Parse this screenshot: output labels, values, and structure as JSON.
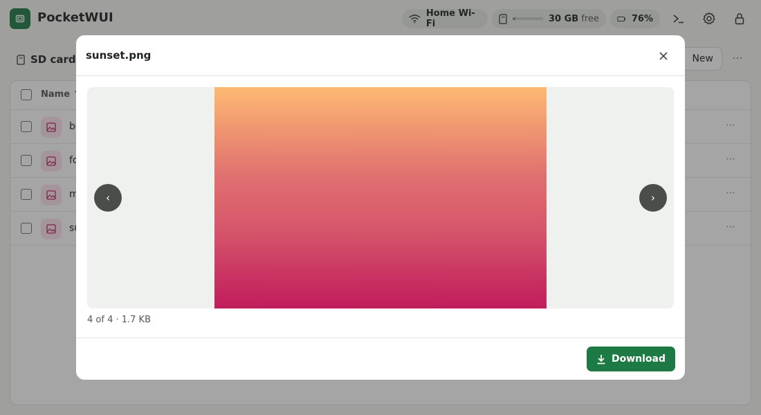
{
  "app": {
    "title": "PocketWUI",
    "logo_icon": "sd-card-icon",
    "accent_color": "#1e7a45"
  },
  "status": {
    "wifi": {
      "icon": "wifi-icon",
      "label": "Home Wi-Fi"
    },
    "storage": {
      "icon": "sd-card-icon",
      "value": "30 GB",
      "unit": "free"
    },
    "battery": {
      "icon": "battery-icon",
      "value": "76%"
    }
  },
  "header_actions": [
    {
      "icon": "terminal-icon"
    },
    {
      "icon": "gear-icon"
    },
    {
      "icon": "lock-icon"
    }
  ],
  "toolbar": {
    "location_icon": "sd-card-icon",
    "location": "SD card",
    "new_label": "New",
    "more": "⋯"
  },
  "table": {
    "columns": {
      "name": "Name ↑"
    },
    "rows": [
      {
        "name": "be",
        "icon": "image-icon"
      },
      {
        "name": "fo",
        "icon": "image-icon"
      },
      {
        "name": "m",
        "icon": "image-icon"
      },
      {
        "name": "su",
        "icon": "image-icon"
      }
    ],
    "row_more": "⋯"
  },
  "modal": {
    "title": "sunset.png",
    "close_icon": "close-icon",
    "prev_label": "‹",
    "next_label": "›",
    "meta": "4 of 4 · 1.7 KB",
    "download_label": "Download",
    "download_icon": "download-icon"
  }
}
